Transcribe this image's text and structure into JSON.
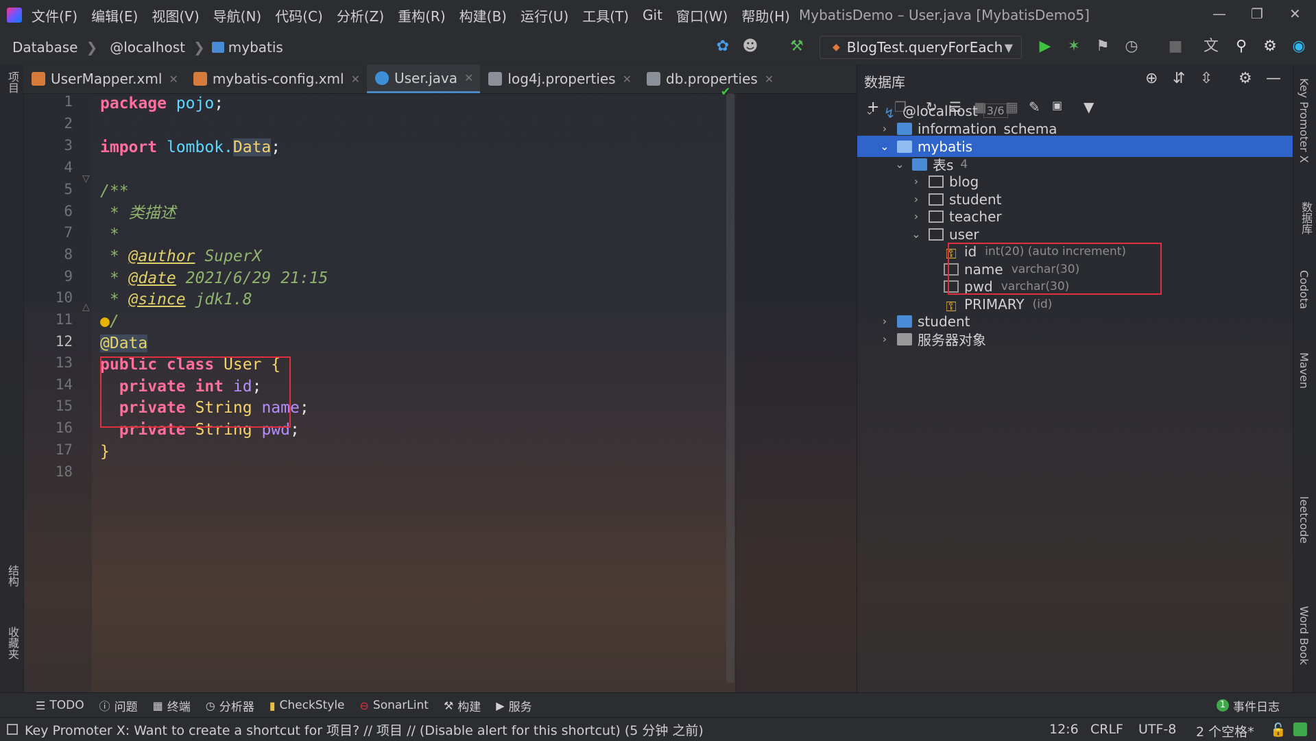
{
  "menu": {
    "items": [
      "文件(F)",
      "编辑(E)",
      "视图(V)",
      "导航(N)",
      "代码(C)",
      "分析(Z)",
      "重构(R)",
      "构建(B)",
      "运行(U)",
      "工具(T)",
      "Git",
      "窗口(W)",
      "帮助(H)"
    ],
    "window_title": "MybatisDemo – User.java [MybatisDemo5]"
  },
  "navbar": {
    "breadcrumbs": [
      "Database",
      "@localhost",
      "mybatis"
    ],
    "run_config": "BlogTest.queryForEach"
  },
  "left_strip": {
    "project_label": "项目",
    "structure_label": "结构",
    "favorites_label": "收藏夹"
  },
  "tabs": [
    {
      "label": "UserMapper.xml"
    },
    {
      "label": "mybatis-config.xml"
    },
    {
      "label": "User.java"
    },
    {
      "label": "log4j.properties"
    },
    {
      "label": "db.properties"
    }
  ],
  "editor": {
    "line_numbers": [
      "1",
      "2",
      "3",
      "4",
      "5",
      "6",
      "7",
      "8",
      "9",
      "10",
      "11",
      "12",
      "13",
      "14",
      "15",
      "16",
      "17",
      "18"
    ],
    "current_line": "12",
    "code": {
      "l1_kw": "package",
      "l1_pkg": "pojo",
      "l1_end": ";",
      "l3_kw": "import",
      "l3_pkg": "lombok.",
      "l3_cls": "Data",
      "l3_end": ";",
      "l5": "/**",
      "l6": " * 类描述",
      "l7": " *",
      "l8_pre": " * ",
      "l8_tag": "@author",
      "l8_val": " SuperX",
      "l9_pre": " * ",
      "l9_tag": "@date",
      "l9_val": " 2021/6/29 21:15",
      "l10_pre": " * ",
      "l10_tag": "@since",
      "l10_val": " jdk1.8",
      "l11": "/",
      "l12": "@Data",
      "l13_kw": "public class",
      "l13_cls": "User",
      "l13_end": "{",
      "l14_kw": "private int",
      "l14_fld": "id",
      "l14_end": ";",
      "l15_kw": "private",
      "l15_type": "String",
      "l15_fld": "name",
      "l15_end": ";",
      "l16_kw": "private",
      "l16_type": "String",
      "l16_fld": "pwd",
      "l16_end": ";",
      "l17": "}"
    }
  },
  "db_panel": {
    "title": "数据库",
    "tree": {
      "host": "@localhost",
      "host_count": "3/6",
      "schema1": "information_schema",
      "schema2": "mybatis",
      "tables_folder": "表s",
      "tables_count": "4",
      "t1": "blog",
      "t2": "student",
      "t3": "teacher",
      "t4": "user",
      "col1": "id",
      "col1_type": "int(20) (auto increment)",
      "col2": "name",
      "col2_type": "varchar(30)",
      "col3": "pwd",
      "col3_type": "varchar(30)",
      "key": "PRIMARY",
      "key_cols": "(id)",
      "schema3": "student",
      "server_objects": "服务器对象"
    }
  },
  "right_strip": {
    "key_promoter": "Key Promoter X",
    "database": "数据库",
    "codota": "Codota",
    "maven": "Maven",
    "leetcode": "leetcode",
    "wordbook": "Word Book"
  },
  "bottom_tools": [
    "TODO",
    "问题",
    "终端",
    "分析器",
    "CheckStyle",
    "SonarLint",
    "构建",
    "服务"
  ],
  "event_log": {
    "count": "1",
    "label": "事件日志"
  },
  "status": {
    "message": "Key Promoter X: Want to create a shortcut for 项目? // 项目 // (Disable alert for this shortcut) (5 分钟 之前)",
    "position": "12:6",
    "line_sep": "CRLF",
    "encoding": "UTF-8",
    "indent": "2 个空格*"
  },
  "colors": {
    "accent": "#2f65ca",
    "highlight_box": "#e03040",
    "run_green": "#3ec13e"
  }
}
